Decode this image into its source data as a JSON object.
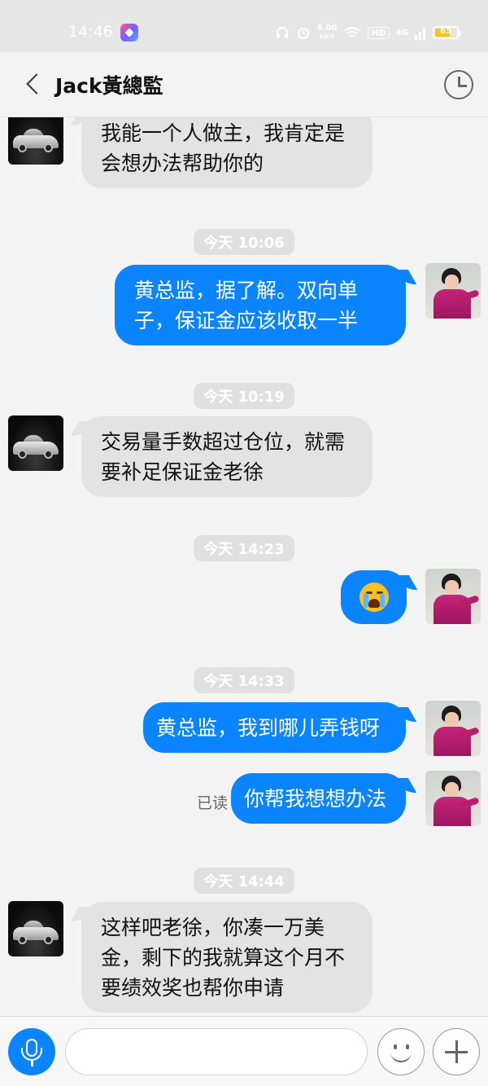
{
  "status_bar": {
    "time": "14:46",
    "net_speed_value": "6.00",
    "net_speed_unit": "KB/S",
    "hd_label": "HD",
    "network_label": "4G",
    "battery_level": "65",
    "icons": [
      "app-badge-icon",
      "headphones-icon",
      "alarm-icon",
      "wifi-icon",
      "hd-icon",
      "signal-icon",
      "battery-icon"
    ]
  },
  "header": {
    "title": "Jack黃總監",
    "back_icon": "chevron-left-icon",
    "history_icon": "clock-icon"
  },
  "messages": [
    {
      "type": "in",
      "text_lines": [
        "我能一个人做主，我肯定是",
        "会想办法帮助你的"
      ]
    },
    {
      "type": "time",
      "text": "今天 10:06"
    },
    {
      "type": "out",
      "text_lines": [
        "黄总监，据了解。双向单",
        "子，保证金应该收取一半"
      ]
    },
    {
      "type": "time",
      "text": "今天 10:19"
    },
    {
      "type": "in",
      "text_lines": [
        "交易量手数超过仓位，就需",
        "要补足保证金老徐"
      ]
    },
    {
      "type": "time",
      "text": "今天 14:23"
    },
    {
      "type": "out",
      "emoji": "loudly-crying-face"
    },
    {
      "type": "time",
      "text": "今天 14:33"
    },
    {
      "type": "out",
      "text_lines": [
        "黄总监，我到哪儿弄钱呀"
      ]
    },
    {
      "type": "out",
      "text_lines": [
        "你帮我想想办法"
      ],
      "status": "已读"
    },
    {
      "type": "time",
      "text": "今天 14:44"
    },
    {
      "type": "in",
      "text_lines": [
        "这样吧老徐，你凑一万美",
        "金，剩下的我就算这个月不",
        "要绩效奖也帮你申请"
      ]
    }
  ],
  "input_bar": {
    "message_value": "",
    "voice_icon": "microphone-icon",
    "emoji_icon": "smiley-icon",
    "more_icon": "plus-icon"
  },
  "colors": {
    "outgoing_bubble": "#0a84ff",
    "incoming_bubble": "#e3e3e3",
    "background": "#f3f3f3",
    "time_pill": "#e0e0e0"
  }
}
